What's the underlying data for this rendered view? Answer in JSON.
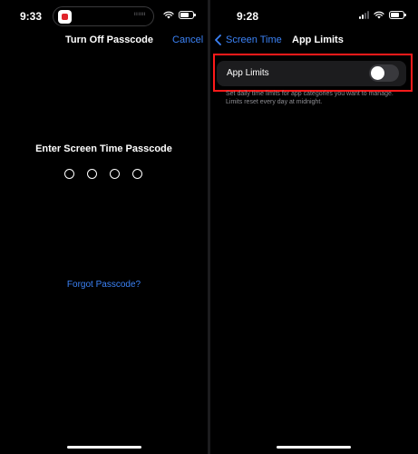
{
  "left_screen": {
    "status_bar": {
      "time": "9:33",
      "island_text": "ıııııı"
    },
    "nav": {
      "title": "Turn Off Passcode",
      "cancel_label": "Cancel"
    },
    "prompt": "Enter Screen Time Passcode",
    "passcode": {
      "digit_count": 4,
      "entered": 0
    },
    "forgot_label": "Forgot Passcode?"
  },
  "right_screen": {
    "status_bar": {
      "time": "9:28"
    },
    "nav": {
      "back_label": "Screen Time",
      "title": "App Limits"
    },
    "row": {
      "label": "App Limits",
      "toggle_on": false
    },
    "footer": "Set daily time limits for app categories you want to manage. Limits reset every day at midnight."
  },
  "colors": {
    "accent": "#3b82f6",
    "highlight": "#ff1a1a",
    "background": "#000000",
    "row_bg": "#1c1c1e"
  }
}
